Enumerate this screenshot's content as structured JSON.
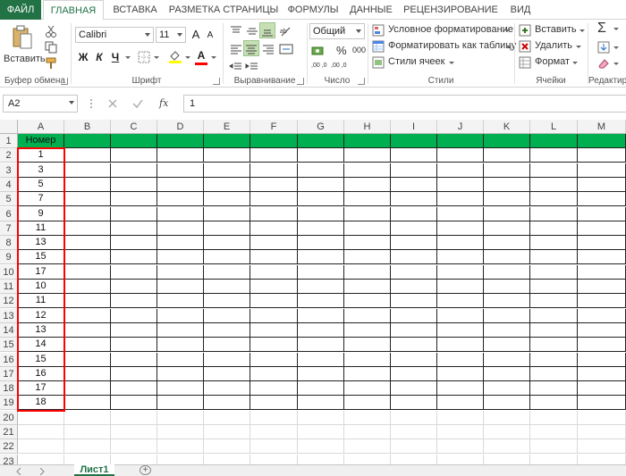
{
  "ribbon_tabs": [
    "ФАЙЛ",
    "ГЛАВНАЯ",
    "ВСТАВКА",
    "РАЗМЕТКА СТРАНИЦЫ",
    "ФОРМУЛЫ",
    "ДАННЫЕ",
    "РЕЦЕНЗИРОВАНИЕ",
    "ВИД"
  ],
  "clipboard": {
    "paste_label": "Вставить",
    "group_label": "Буфер обмена"
  },
  "font": {
    "name": "Calibri",
    "size": "11",
    "bold": "Ж",
    "italic": "К",
    "underline": "Ч",
    "grow": "A",
    "shrink": "A",
    "color_letter": "A",
    "group_label": "Шрифт"
  },
  "alignment": {
    "group_label": "Выравнивание"
  },
  "number": {
    "format": "Общий",
    "percent": "%",
    "thousands": "000",
    "inc_decimal": ",00 ,0",
    "dec_decimal": ",00 ,0",
    "group_label": "Число"
  },
  "styles": {
    "conditional": "Условное форматирование",
    "as_table": "Форматировать как таблицу",
    "cell_styles": "Стили ячеек",
    "group_label": "Стили"
  },
  "cells": {
    "insert": "Вставить",
    "delete": "Удалить",
    "format": "Формат",
    "group_label": "Ячейки"
  },
  "editing": {
    "sum": "Σ",
    "group_label": "Редактир"
  },
  "formula_bar": {
    "name_box": "A2",
    "fx": "fx",
    "value": "1"
  },
  "columns": [
    "A",
    "B",
    "C",
    "D",
    "E",
    "F",
    "G",
    "H",
    "I",
    "J",
    "K",
    "L",
    "M"
  ],
  "rows": [
    "1",
    "2",
    "3",
    "4",
    "5",
    "6",
    "7",
    "8",
    "9",
    "10",
    "11",
    "12",
    "13",
    "14",
    "15",
    "16",
    "17",
    "18",
    "19",
    "20",
    "21",
    "22",
    "23"
  ],
  "header_cell": "Номер",
  "column_a_values": [
    "1",
    "3",
    "5",
    "7",
    "9",
    "11",
    "13",
    "15",
    "17",
    "10",
    "11",
    "12",
    "13",
    "14",
    "15",
    "16",
    "17",
    "18"
  ],
  "sheet_tab": "Лист1",
  "add_sheet": "⊕",
  "colors": {
    "header_fill": "#00b050",
    "selection_outline": "#ff0000",
    "excel_green": "#217346"
  }
}
